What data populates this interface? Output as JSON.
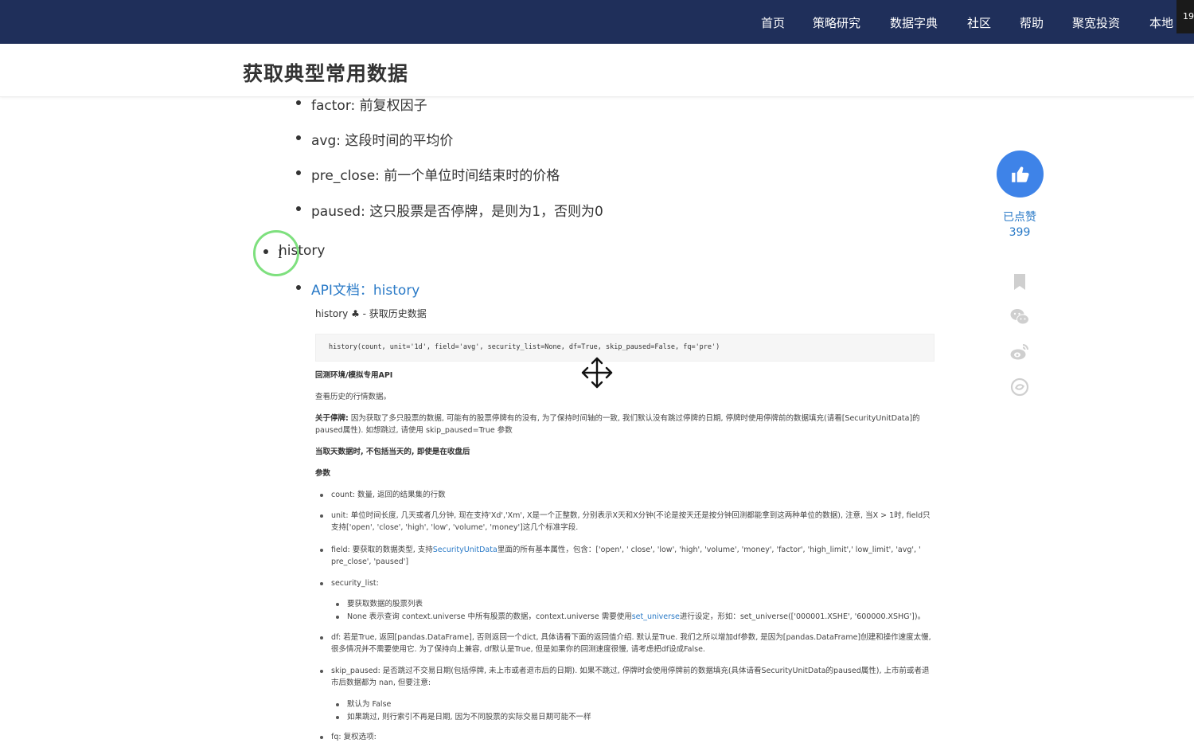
{
  "nav": {
    "items": [
      "首页",
      "策略研究",
      "数据字典",
      "社区",
      "帮助",
      "聚宽投资",
      "本地"
    ],
    "corner": "19"
  },
  "page": {
    "title": "获取典型常用数据"
  },
  "content": {
    "fields": [
      "factor: 前复权因子",
      "avg: 这段时间的平均价",
      "pre_close: 前一个单位时间结束时的价格",
      "paused: 这只股票是否停牌，是则为1，否则为0"
    ],
    "history_item": "history",
    "api_link": "API文档：history"
  },
  "doc": {
    "title": "history ♣ - 获取历史数据",
    "code": "history(count, unit='1d', field='avg', security_list=None, df=True, skip_paused=False, fq='pre')",
    "env": "回测环境/模拟专用API",
    "desc": "查看历史的行情数据。",
    "pause_label": "关于停牌:",
    "pause_text": "因为获取了多只股票的数据, 可能有的股票停牌有的没有, 为了保持时间轴的一致, 我们默认没有跳过停牌的日期, 停牌时使用停牌前的数据填充(请看[SecurityUnitData]的paused属性). 如想跳过, 请使用 skip_paused=True 参数",
    "today_note": "当取天数据时, 不包括当天的, 即使是在收盘后",
    "params_heading": "参数",
    "count": "count: 数量, 返回的结果集的行数",
    "unit": "unit: 单位时间长度, 几天或者几分钟, 现在支持'Xd','Xm', X是一个正整数, 分别表示X天和X分钟(不论是按天还是按分钟回测都能拿到这两种单位的数据), 注意, 当X > 1时, field只支持['open', 'close', 'high', 'low', 'volume', 'money']这几个标准字段.",
    "field_prefix": "field: 要获取的数据类型, 支持",
    "field_link": "SecurityUnitData",
    "field_suffix": "里面的所有基本属性，包含：['open', ' close', 'low', 'high', 'volume', 'money', 'factor', 'high_limit',' low_limit', 'avg', ' pre_close', 'paused']",
    "security_list": "security_list:",
    "sl_sub1": "要获取数据的股票列表",
    "sl_sub2_prefix": "None 表示查询 context.universe 中所有股票的数据，context.universe 需要使用",
    "sl_sub2_link": "set_universe",
    "sl_sub2_suffix": "进行设定，形如：set_universe(['000001.XSHE', '600000.XSHG'])。",
    "df": "df: 若是True, 返回[pandas.DataFrame], 否则返回一个dict, 具体请看下面的返回值介绍. 默认是True. 我们之所以增加df参数, 是因为[pandas.DataFrame]创建和操作速度太慢, 很多情况并不需要使用它. 为了保持向上兼容, df默认是True, 但是如果你的回测速度很慢, 请考虑把df设成False.",
    "skip_paused": "skip_paused: 是否跳过不交易日期(包括停牌, 未上市或者退市后的日期). 如果不跳过, 停牌时会使用停牌前的数据填充(具体请看SecurityUnitData的paused属性), 上市前或者退市后数据都为 nan, 但要注意:",
    "sp_sub1": "默认为 False",
    "sp_sub2": "如果跳过, 则行索引不再是日期, 因为不同股票的实际交易日期可能不一样",
    "fq": "fq: 复权选项:"
  },
  "social": {
    "like_label": "已点赞",
    "like_count": "399",
    "accent": "#3e83e8",
    "icons": [
      "thumbs-up-icon",
      "bookmark-icon",
      "wechat-icon",
      "weibo-icon",
      "douban-icon"
    ]
  },
  "colors": {
    "nav_bg": "#1f2f5a",
    "link": "#2a7ac7",
    "cursor_ring": "#7ee07e"
  }
}
